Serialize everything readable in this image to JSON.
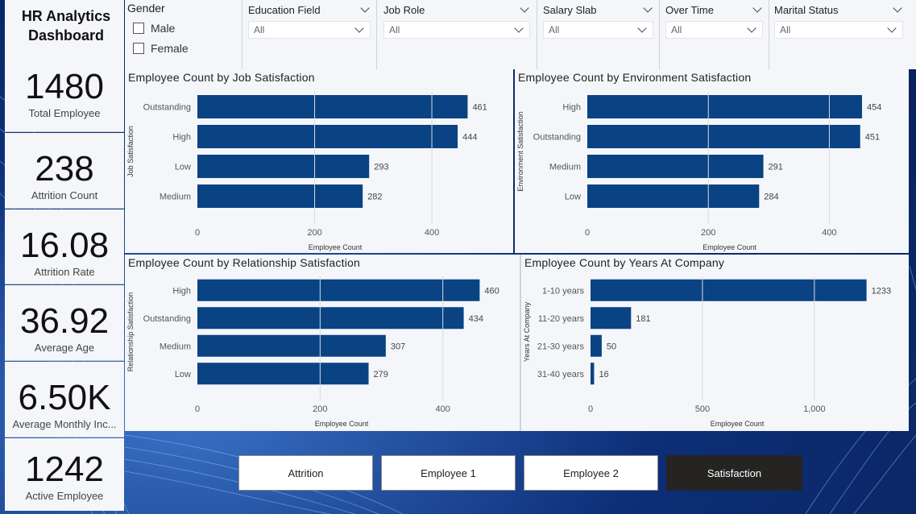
{
  "dashboard": {
    "title": "HR Analytics Dashboard"
  },
  "kpis": [
    {
      "value": "1480",
      "label": "Total Employee"
    },
    {
      "value": "238",
      "label": "Attrition Count"
    },
    {
      "value": "16.08",
      "label": "Attrition Rate"
    },
    {
      "value": "36.92",
      "label": "Average Age"
    },
    {
      "value": "6.50K",
      "label": "Average Monthly Inc..."
    },
    {
      "value": "1242",
      "label": "Active Employee"
    }
  ],
  "slicers": {
    "gender": {
      "label": "Gender",
      "options": [
        "Male",
        "Female"
      ]
    },
    "dropdowns": [
      {
        "label": "Education Field",
        "value": "All"
      },
      {
        "label": "Job Role",
        "value": "All"
      },
      {
        "label": "Salary Slab",
        "value": "All"
      },
      {
        "label": "Over Time",
        "value": "All"
      },
      {
        "label": "Marital Status",
        "value": "All"
      }
    ]
  },
  "colors": {
    "bar": "#0a4384",
    "active_nav": "#252423"
  },
  "chart_data": [
    {
      "type": "bar",
      "orientation": "horizontal",
      "title": "Employee Count by Job Satisfaction",
      "ylabel": "Job Satisfaction",
      "xlabel": "Employee Count",
      "categories": [
        "Outstanding",
        "High",
        "Low",
        "Medium"
      ],
      "values": [
        461,
        444,
        293,
        282
      ],
      "xticks": [
        0,
        200,
        400
      ],
      "xlim": [
        0,
        470
      ]
    },
    {
      "type": "bar",
      "orientation": "horizontal",
      "title": "Employee Count by Environment Satisfaction",
      "ylabel": "Environment Satisfaction",
      "xlabel": "Employee Count",
      "categories": [
        "High",
        "Outstanding",
        "Medium",
        "Low"
      ],
      "values": [
        454,
        451,
        291,
        284
      ],
      "xticks": [
        0,
        200,
        400
      ],
      "xlim": [
        0,
        470
      ]
    },
    {
      "type": "bar",
      "orientation": "horizontal",
      "title": "Employee Count by Relationship Satisfaction",
      "ylabel": "Relationship Satisfaction",
      "xlabel": "Employee Count",
      "categories": [
        "High",
        "Outstanding",
        "Medium",
        "Low"
      ],
      "values": [
        460,
        434,
        307,
        279
      ],
      "xticks": [
        0,
        200,
        400
      ],
      "xlim": [
        0,
        470
      ]
    },
    {
      "type": "bar",
      "orientation": "horizontal",
      "title": "Employee Count by Years At Company",
      "ylabel": "Years At Company",
      "xlabel": "Employee Count",
      "categories": [
        "1-10 years",
        "11-20 years",
        "21-30 years",
        "31-40 years"
      ],
      "values": [
        1233,
        181,
        50,
        16
      ],
      "xticks": [
        0,
        500,
        1000
      ],
      "xtick_labels": [
        "0",
        "500",
        "1,000"
      ],
      "xlim": [
        0,
        1310
      ]
    }
  ],
  "nav": {
    "buttons": [
      "Attrition",
      "Employee 1",
      "Employee 2",
      "Satisfaction"
    ],
    "active": "Satisfaction"
  }
}
